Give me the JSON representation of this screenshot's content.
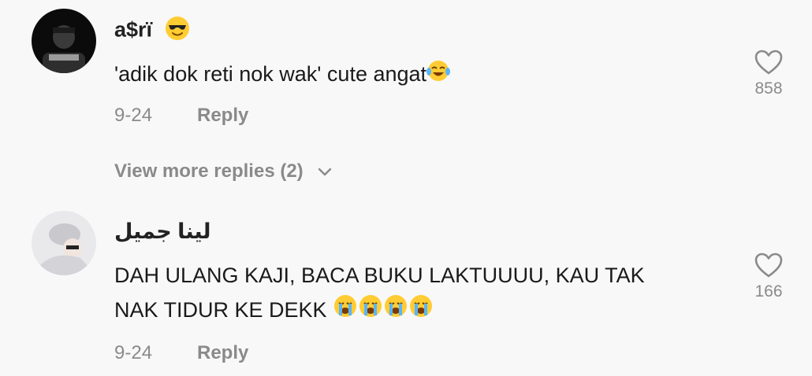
{
  "comments": [
    {
      "username": "a$rï",
      "username_emoji": "smiling-face-with-sunglasses",
      "text": "'adik dok reti nok wak' cute angat",
      "text_emojis": [
        "face-with-tears-of-joy"
      ],
      "date": "9-24",
      "reply_label": "Reply",
      "like_count": "858",
      "view_more_label": "View more replies (2)"
    },
    {
      "username": "لينا جميل",
      "text_line1": "DAH ULANG KAJI, BACA BUKU LAKTUUUU, KAU TAK",
      "text_line2": "NAK TIDUR KE DEKK",
      "text_emojis": [
        "loudly-crying-face",
        "loudly-crying-face",
        "loudly-crying-face",
        "loudly-crying-face"
      ],
      "date": "9-24",
      "reply_label": "Reply",
      "like_count": "166"
    }
  ],
  "colors": {
    "background": "#f8f8f8",
    "username": "#222222",
    "text": "#1a1a1a",
    "muted": "#8a8a8a"
  }
}
